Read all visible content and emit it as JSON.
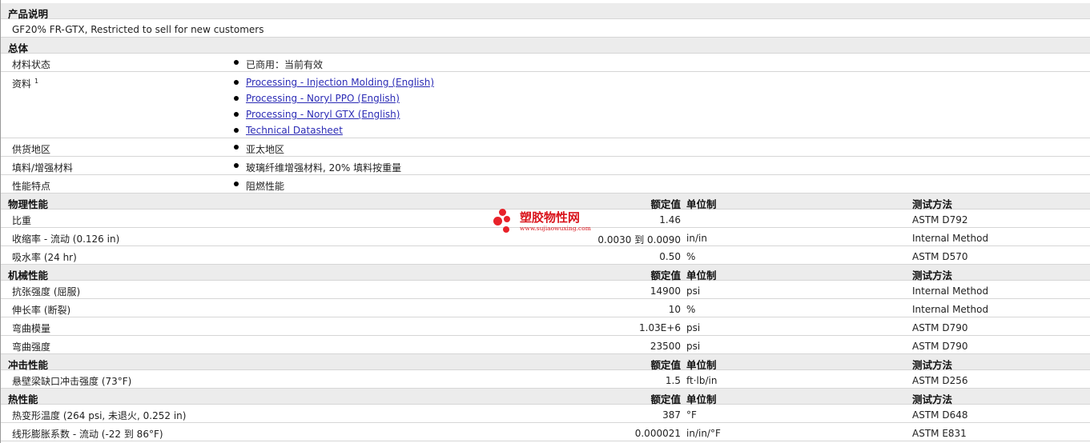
{
  "product_description": {
    "title": "产品说明",
    "text": "GF20% FR-GTX, Restricted to sell for new customers"
  },
  "general": {
    "title": "总体",
    "material_status": {
      "label": "材料状态",
      "value": "已商用：当前有效"
    },
    "documents": {
      "label": "资料",
      "footnote": "1",
      "links": [
        "Processing - Injection Molding (English)",
        "Processing - Noryl PPO (English)",
        "Processing - Noryl GTX (English)",
        "Technical Datasheet"
      ]
    },
    "availability": {
      "label": "供货地区",
      "value": "亚太地区"
    },
    "filler": {
      "label": "填料/增强材料",
      "value": "玻璃纤维增强材料, 20% 填料按重量"
    },
    "features": {
      "label": "性能特点",
      "value": "阻燃性能"
    }
  },
  "headers": {
    "nominal": "额定值",
    "unit": "单位制",
    "method": "测试方法"
  },
  "sections": [
    {
      "title": "物理性能",
      "rows": [
        {
          "name": "比重",
          "value": "1.46",
          "unit": "",
          "method": "ASTM D792"
        },
        {
          "name": "收缩率 - 流动 (0.126 in)",
          "value": "0.0030 到  0.0090",
          "unit": "in/in",
          "method": "Internal Method"
        },
        {
          "name": "吸水率 (24 hr)",
          "value": "0.50",
          "unit": "%",
          "method": "ASTM D570"
        }
      ]
    },
    {
      "title": "机械性能",
      "rows": [
        {
          "name": "抗张强度 (屈服)",
          "value": "14900",
          "unit": "psi",
          "method": "Internal Method"
        },
        {
          "name": "伸长率 (断裂)",
          "value": "10",
          "unit": "%",
          "method": "Internal Method"
        },
        {
          "name": "弯曲模量",
          "value": "1.03E+6",
          "unit": "psi",
          "method": "ASTM D790"
        },
        {
          "name": "弯曲强度",
          "value": "23500",
          "unit": "psi",
          "method": "ASTM D790"
        }
      ]
    },
    {
      "title": "冲击性能",
      "rows": [
        {
          "name": "悬壁梁缺口冲击强度 (73°F)",
          "value": "1.5",
          "unit": "ft·lb/in",
          "method": "ASTM D256"
        }
      ]
    },
    {
      "title": "热性能",
      "rows": [
        {
          "name": "热变形温度 (264 psi, 未退火, 0.252 in)",
          "value": "387",
          "unit": "°F",
          "method": "ASTM D648"
        },
        {
          "name": "线形膨胀系数 - 流动 (-22 到  86°F)",
          "value": "0.000021",
          "unit": "in/in/°F",
          "method": "ASTM E831"
        }
      ]
    }
  ],
  "watermark": {
    "brand": "塑胶物性网",
    "url": "www.sujiaowuxing.com"
  }
}
